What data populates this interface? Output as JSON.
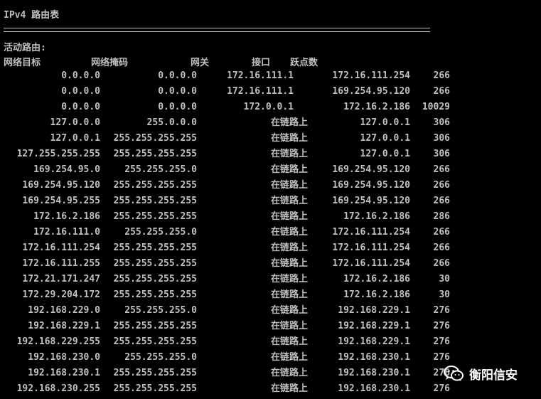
{
  "heading": "IPv4 路由表",
  "section_title": "活动路由:",
  "columns": {
    "dest": "网络目标",
    "mask": "网络掩码",
    "gateway": "网关",
    "interface": "接口",
    "metric": "跃点数"
  },
  "routes": [
    {
      "dest": "0.0.0.0",
      "mask": "0.0.0.0",
      "gateway": "172.16.111.1",
      "iface": "172.16.111.254",
      "metric": "266"
    },
    {
      "dest": "0.0.0.0",
      "mask": "0.0.0.0",
      "gateway": "172.16.111.1",
      "iface": "169.254.95.120",
      "metric": "266"
    },
    {
      "dest": "0.0.0.0",
      "mask": "0.0.0.0",
      "gateway": "172.0.0.1",
      "iface": "172.16.2.186",
      "metric": "10029"
    },
    {
      "dest": "127.0.0.0",
      "mask": "255.0.0.0",
      "gateway": "在链路上",
      "iface": "127.0.0.1",
      "metric": "306"
    },
    {
      "dest": "127.0.0.1",
      "mask": "255.255.255.255",
      "gateway": "在链路上",
      "iface": "127.0.0.1",
      "metric": "306"
    },
    {
      "dest": "127.255.255.255",
      "mask": "255.255.255.255",
      "gateway": "在链路上",
      "iface": "127.0.0.1",
      "metric": "306"
    },
    {
      "dest": "169.254.95.0",
      "mask": "255.255.255.0",
      "gateway": "在链路上",
      "iface": "169.254.95.120",
      "metric": "266"
    },
    {
      "dest": "169.254.95.120",
      "mask": "255.255.255.255",
      "gateway": "在链路上",
      "iface": "169.254.95.120",
      "metric": "266"
    },
    {
      "dest": "169.254.95.255",
      "mask": "255.255.255.255",
      "gateway": "在链路上",
      "iface": "169.254.95.120",
      "metric": "266"
    },
    {
      "dest": "172.16.2.186",
      "mask": "255.255.255.255",
      "gateway": "在链路上",
      "iface": "172.16.2.186",
      "metric": "286"
    },
    {
      "dest": "172.16.111.0",
      "mask": "255.255.255.0",
      "gateway": "在链路上",
      "iface": "172.16.111.254",
      "metric": "266"
    },
    {
      "dest": "172.16.111.254",
      "mask": "255.255.255.255",
      "gateway": "在链路上",
      "iface": "172.16.111.254",
      "metric": "266"
    },
    {
      "dest": "172.16.111.255",
      "mask": "255.255.255.255",
      "gateway": "在链路上",
      "iface": "172.16.111.254",
      "metric": "266"
    },
    {
      "dest": "172.21.171.247",
      "mask": "255.255.255.255",
      "gateway": "在链路上",
      "iface": "172.16.2.186",
      "metric": "30"
    },
    {
      "dest": "172.29.204.172",
      "mask": "255.255.255.255",
      "gateway": "在链路上",
      "iface": "172.16.2.186",
      "metric": "30"
    },
    {
      "dest": "192.168.229.0",
      "mask": "255.255.255.0",
      "gateway": "在链路上",
      "iface": "192.168.229.1",
      "metric": "276"
    },
    {
      "dest": "192.168.229.1",
      "mask": "255.255.255.255",
      "gateway": "在链路上",
      "iface": "192.168.229.1",
      "metric": "276"
    },
    {
      "dest": "192.168.229.255",
      "mask": "255.255.255.255",
      "gateway": "在链路上",
      "iface": "192.168.229.1",
      "metric": "276"
    },
    {
      "dest": "192.168.230.0",
      "mask": "255.255.255.0",
      "gateway": "在链路上",
      "iface": "192.168.230.1",
      "metric": "276"
    },
    {
      "dest": "192.168.230.1",
      "mask": "255.255.255.255",
      "gateway": "在链路上",
      "iface": "192.168.230.1",
      "metric": "276"
    },
    {
      "dest": "192.168.230.255",
      "mask": "255.255.255.255",
      "gateway": "在链路上",
      "iface": "192.168.230.1",
      "metric": "276"
    }
  ],
  "watermark": {
    "icon": "wechat-icon",
    "text": "衡阳信安"
  },
  "colors": {
    "background": "#000000",
    "text": "#c0c0c0",
    "watermark": "#ffffff"
  }
}
